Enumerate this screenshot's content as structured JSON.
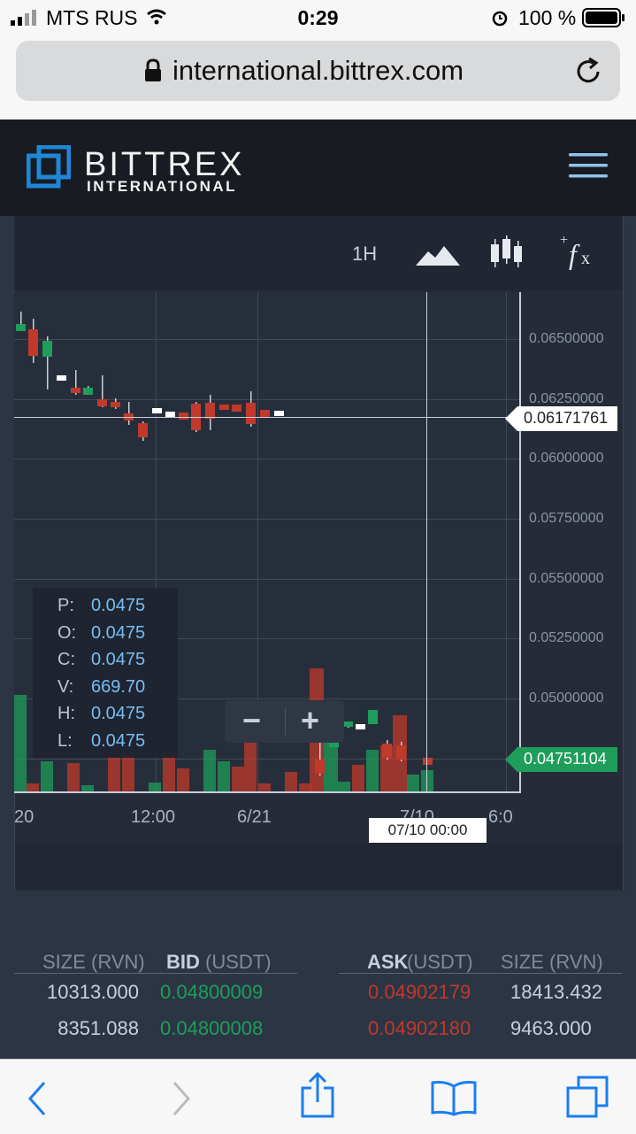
{
  "status_bar": {
    "carrier": "MTS RUS",
    "time": "0:29",
    "battery": "100 %",
    "icons": [
      "signal-icon",
      "wifi-icon",
      "alarm-icon",
      "battery-icon"
    ]
  },
  "browser": {
    "url": "international.bittrex.com",
    "icons": [
      "lock-icon",
      "reload-icon"
    ]
  },
  "header": {
    "brand": "BITTREX",
    "subtitle": "INTERNATIONAL",
    "menu_icon": "hamburger-icon",
    "brand_color": "#1e88d6"
  },
  "toolbar": {
    "timeframe": "1H",
    "icons": [
      "area-chart-icon",
      "candlestick-icon",
      "fx-indicators-icon"
    ]
  },
  "chart_data": {
    "type": "candlestick",
    "y_ticks": [
      "0.06500000",
      "0.06250000",
      "0.06000000",
      "0.05750000",
      "0.05500000",
      "0.05250000",
      "0.05000000"
    ],
    "x_ticks": [
      "20",
      "12:00",
      "6/21",
      "7/10",
      "6:0"
    ],
    "crosshair_price": "0.06171761",
    "last_price": "0.04751104",
    "crosshair_time": "07/10 00:00",
    "ohlc_tooltip": {
      "labels": [
        "P:",
        "O:",
        "C:",
        "V:",
        "H:",
        "L:"
      ],
      "values": [
        "0.0475",
        "0.0475",
        "0.0475",
        "669.70",
        "0.0475",
        "0.0475"
      ]
    },
    "up_color": "#1e9e5a",
    "down_color": "#c0392b"
  },
  "zoom": {
    "minus": "−",
    "plus": "+"
  },
  "order_book": {
    "bid_headers": {
      "size": "SIZE (RVN)",
      "bid": "BID",
      "bid_unit": " (USDT)"
    },
    "ask_headers": {
      "ask": "ASK",
      "ask_unit": " (USDT)",
      "size": "SIZE (RVN)"
    },
    "bids": [
      {
        "size": "10313.000",
        "price": "0.04800009"
      },
      {
        "size": "8351.088",
        "price": "0.04800008"
      }
    ],
    "asks": [
      {
        "price": "0.04902179",
        "size": "18413.432"
      },
      {
        "price": "0.04902180",
        "size": "9463.000"
      }
    ]
  },
  "bottom_bar": {
    "icons": [
      "back-icon",
      "forward-icon",
      "share-icon",
      "bookmarks-icon",
      "tabs-icon"
    ]
  }
}
